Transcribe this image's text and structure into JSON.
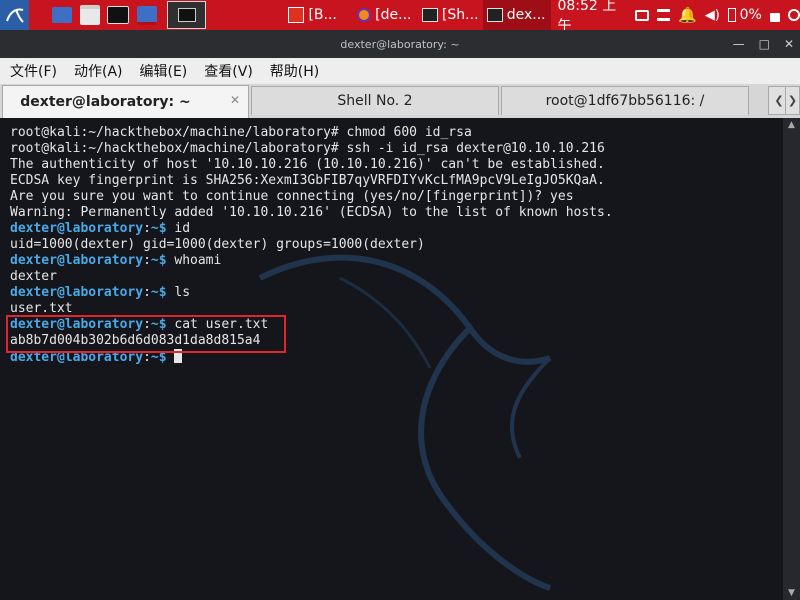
{
  "panel": {
    "tasks": [
      {
        "label": "[B...",
        "icon": "folder-red-icon"
      },
      {
        "label": "[de...",
        "icon": "firefox-icon"
      },
      {
        "label": "[Sh...",
        "icon": "terminal-icon"
      },
      {
        "label": "dex...",
        "icon": "terminal-icon"
      }
    ],
    "clock": "08:52 上午",
    "battery": "0%"
  },
  "window": {
    "title": "dexter@laboratory: ~",
    "menu": [
      "文件(F)",
      "动作(A)",
      "编辑(E)",
      "查看(V)",
      "帮助(H)"
    ],
    "tabs": [
      "dexter@laboratory: ~",
      "Shell No. 2",
      "root@1df67bb56116: /"
    ]
  },
  "terminal": {
    "lines": [
      "root@kali:~/hackthebox/machine/laboratory# chmod 600 id_rsa",
      "root@kali:~/hackthebox/machine/laboratory# ssh -i id_rsa dexter@10.10.10.216",
      "The authenticity of host '10.10.10.216 (10.10.10.216)' can't be established.",
      "ECDSA key fingerprint is SHA256:XexmI3GbFIB7qyVRFDIYvKcLfMA9pcV9LeIgJO5KQaA.",
      "Are you sure you want to continue connecting (yes/no/[fingerprint])? yes",
      "Warning: Permanently added '10.10.10.216' (ECDSA) to the list of known hosts.",
      "uid=1000(dexter) gid=1000(dexter) groups=1000(dexter)",
      "dexter",
      "user.txt",
      "ab8b7d004b302b6d6d083d1da8d815a4"
    ],
    "prompt_user": "dexter@laboratory",
    "prompt_sep": ":",
    "prompt_path": "~$",
    "commands": {
      "id": " id",
      "whoami": " whoami",
      "ls": " ls",
      "cat": " cat user.txt",
      "empty": " "
    }
  },
  "colors": {
    "panel": "#c8141e",
    "prompt": "#4aa9e8",
    "highlight": "#e0252e"
  }
}
